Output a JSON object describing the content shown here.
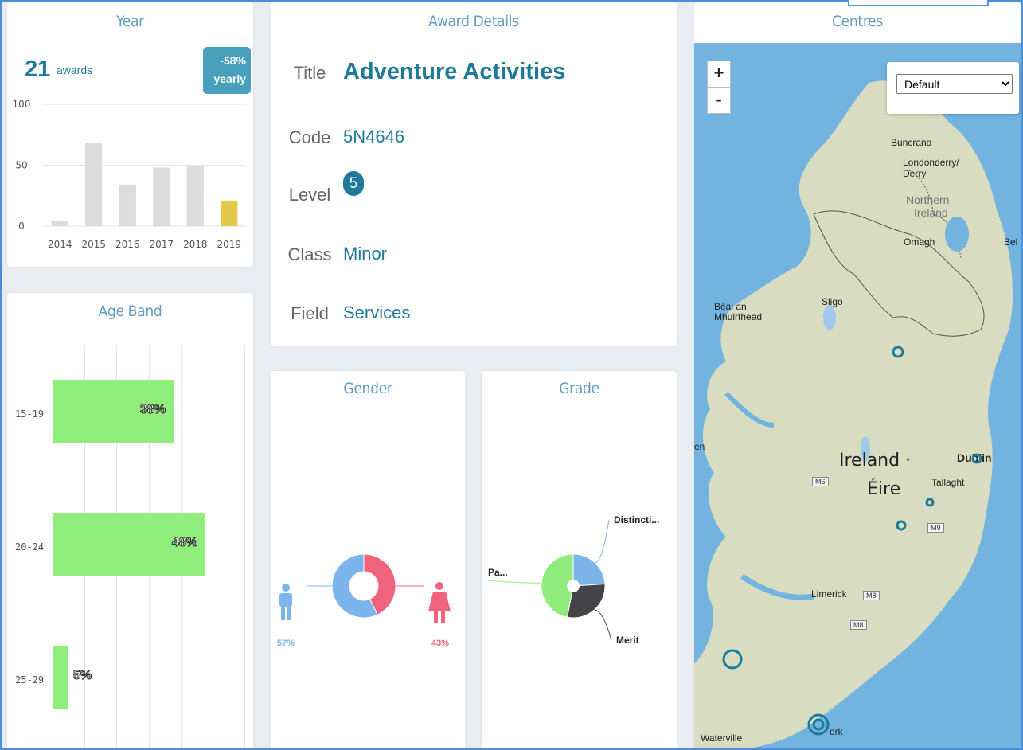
{
  "year_card": {
    "title": "Year",
    "total": "21",
    "total_label": "awards",
    "badge_line1": "-58%",
    "badge_line2": "yearly",
    "y_ticks": [
      "100",
      "50",
      "0"
    ],
    "bar_color": "#dcdcdc",
    "highlight_color": "#e3c94a"
  },
  "age_card": {
    "title": "Age Band",
    "bar_color": "#90ee7c"
  },
  "award_details": {
    "title": "Award Details",
    "rows": {
      "title_label": "Title",
      "title_value": "Adventure Activities",
      "code_label": "Code",
      "code_value": "5N4646",
      "level_label": "Level",
      "level_value": "5",
      "class_label": "Class",
      "class_value": "Minor",
      "field_label": "Field",
      "field_value": "Services"
    }
  },
  "gender_card": {
    "title": "Gender",
    "male_color": "#7cb5ec",
    "female_color": "#f0637e"
  },
  "grade_card": {
    "title": "Grade"
  },
  "centres_card": {
    "title": "Centres",
    "zoom_in": "+",
    "zoom_out": "-",
    "layer_select": {
      "selected": "Default",
      "options": [
        "Default"
      ]
    },
    "map": {
      "country_label": "Ireland ·",
      "country_label_irish": "Éire",
      "ni_label_1": "Northern",
      "ni_label_2": "Ireland",
      "places": [
        "Buncrana",
        "Londonderry/",
        "Derry",
        "Omagh",
        "Bel",
        "Sligo",
        "Béal an",
        "Mhuirthead",
        "Dublin",
        "Tallaght",
        "Limerick",
        "Waterville",
        "ork",
        "en"
      ],
      "roads": [
        "M6",
        "M9",
        "M8",
        "M8"
      ]
    }
  },
  "chart_data": [
    {
      "type": "bar",
      "categories": [
        "2014",
        "2015",
        "2016",
        "2017",
        "2018",
        "2019"
      ],
      "values": [
        4,
        68,
        34,
        48,
        49,
        21
      ],
      "title": "Year",
      "ylim": [
        0,
        100
      ],
      "y_ticks": [
        0,
        50,
        100
      ],
      "grid": true
    },
    {
      "type": "bar",
      "orientation": "horizontal",
      "title": "Age Band",
      "categories": [
        "15-19",
        "20-24",
        "25-29"
      ],
      "values": [
        38,
        48,
        5
      ],
      "value_labels": [
        "38%",
        "48%",
        "5%"
      ],
      "grid": true
    },
    {
      "type": "pie",
      "title": "Gender",
      "donut": true,
      "slices": [
        {
          "label": "57%",
          "value": 57,
          "color": "#7cb5ec"
        },
        {
          "label": "43%",
          "value": 43,
          "color": "#f0637e"
        }
      ]
    },
    {
      "type": "pie",
      "title": "Grade",
      "slices": [
        {
          "label": "Distincti...",
          "value": 24,
          "color": "#7cb5ec"
        },
        {
          "label": "Merit",
          "value": 29,
          "color": "#434348"
        },
        {
          "label": "Pa...",
          "value": 47,
          "color": "#90ed7d"
        }
      ]
    }
  ]
}
